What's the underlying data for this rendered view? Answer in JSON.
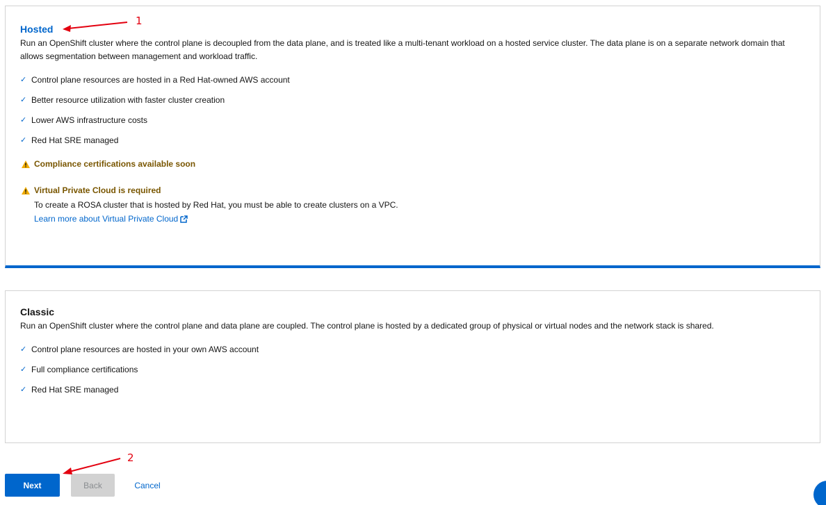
{
  "hosted": {
    "title": "Hosted",
    "description": "Run an OpenShift cluster where the control plane is decoupled from the data plane, and is treated like a multi-tenant workload on a hosted service cluster. The data plane is on a separate network domain that allows segmentation between management and workload traffic.",
    "features": [
      "Control plane resources are hosted in a Red Hat-owned AWS account",
      "Better resource utilization with faster cluster creation",
      "Lower AWS infrastructure costs",
      "Red Hat SRE managed"
    ],
    "warning_compliance": "Compliance certifications available soon",
    "warning_vpc_title": "Virtual Private Cloud is required",
    "warning_vpc_body": "To create a ROSA cluster that is hosted by Red Hat, you must be able to create clusters on a VPC.",
    "warning_vpc_link": "Learn more about Virtual Private Cloud"
  },
  "classic": {
    "title": "Classic",
    "description": "Run an OpenShift cluster where the control plane and data plane are coupled. The control plane is hosted by a dedicated group of physical or virtual nodes and the network stack is shared.",
    "features": [
      "Control plane resources are hosted in your own AWS account",
      "Full compliance certifications",
      "Red Hat SRE managed"
    ]
  },
  "actions": {
    "next": "Next",
    "back": "Back",
    "cancel": "Cancel"
  },
  "annotations": {
    "one": "1",
    "two": "2"
  },
  "icons": {
    "check": "check-icon",
    "warning": "warning-triangle-icon",
    "external": "external-link-icon"
  },
  "colors": {
    "accent": "#0066cc",
    "warning": "#f0ab00",
    "warning_text": "#795600",
    "annotation": "#e3000f"
  }
}
